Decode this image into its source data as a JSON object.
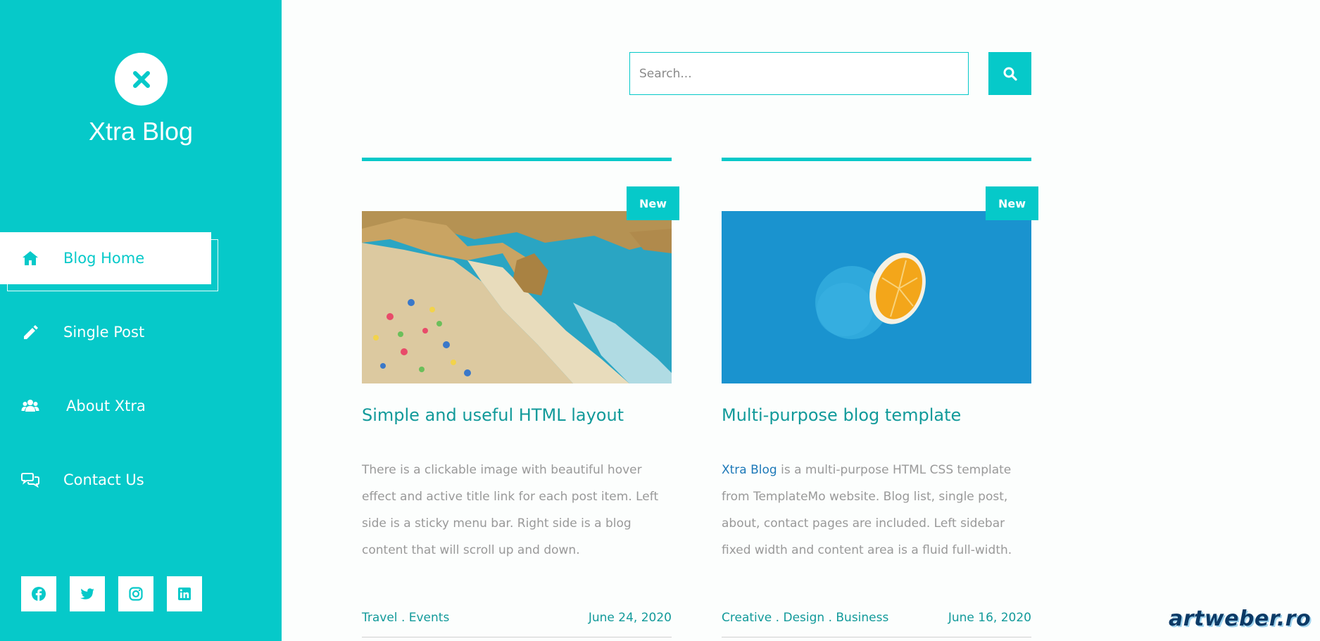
{
  "brand": {
    "name": "Xtra Blog",
    "logo_icon": "close-x-icon"
  },
  "nav": {
    "items": [
      {
        "label": "Blog Home",
        "icon": "home-icon",
        "active": true
      },
      {
        "label": "Single Post",
        "icon": "pencil-icon",
        "active": false
      },
      {
        "label": "About Xtra",
        "icon": "users-icon",
        "active": false
      },
      {
        "label": "Contact Us",
        "icon": "comments-icon",
        "active": false
      }
    ]
  },
  "socials": [
    {
      "icon": "facebook-icon"
    },
    {
      "icon": "twitter-icon"
    },
    {
      "icon": "instagram-icon"
    },
    {
      "icon": "linkedin-icon"
    }
  ],
  "search": {
    "placeholder": "Search...",
    "value": "",
    "button_icon": "search-icon"
  },
  "posts": [
    {
      "badge": "New",
      "image": "beach-photo",
      "title": "Simple and useful HTML layout",
      "text": "There is a clickable image with beautiful hover effect and active title link for each post item. Left side is a sticky menu bar. Right side is a blog content that will scroll up and down.",
      "tags": "Travel . Events",
      "date": "June 24, 2020"
    },
    {
      "badge": "New",
      "image": "orange-on-blue-photo",
      "title": "Multi-purpose blog template",
      "text_link": "Xtra Blog",
      "text": " is a multi-purpose HTML CSS template from TemplateMo website. Blog list, single post, about, contact pages are included. Left sidebar fixed width and content area is a fluid full-width.",
      "tags": "Creative . Design . Business",
      "date": "June 16, 2020"
    }
  ],
  "watermark": "artweber.ro",
  "colors": {
    "accent": "#06c9c9",
    "title": "#129a9a",
    "link": "#1d79b8",
    "body_text": "#999999"
  }
}
